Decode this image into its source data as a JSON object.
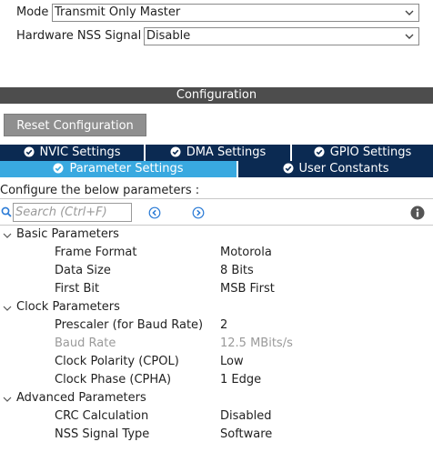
{
  "mode": {
    "label": "Mode",
    "value": "Transmit Only Master"
  },
  "nss": {
    "label": "Hardware NSS Signal",
    "value": "Disable"
  },
  "configuration": {
    "title": "Configuration",
    "reset_label": "Reset Configuration",
    "tabs_row1": [
      {
        "label": "NVIC Settings",
        "icon": "check-circle-icon"
      },
      {
        "label": "DMA Settings",
        "icon": "check-circle-icon"
      },
      {
        "label": "GPIO Settings",
        "icon": "check-circle-icon"
      }
    ],
    "tabs_row2": [
      {
        "label": "Parameter Settings",
        "icon": "check-circle-icon",
        "active": true
      },
      {
        "label": "User Constants",
        "icon": "check-circle-icon",
        "active": false
      }
    ],
    "note": "Configure the below parameters :",
    "search_placeholder": "Search (Ctrl+F)",
    "groups": [
      {
        "name": "Basic Parameters",
        "params": [
          {
            "name": "Frame Format",
            "value": "Motorola"
          },
          {
            "name": "Data Size",
            "value": "8 Bits"
          },
          {
            "name": "First Bit",
            "value": "MSB First"
          }
        ]
      },
      {
        "name": "Clock Parameters",
        "params": [
          {
            "name": "Prescaler (for Baud Rate)",
            "value": "2"
          },
          {
            "name": "Baud Rate",
            "value": "12.5 MBits/s",
            "disabled": true
          },
          {
            "name": "Clock Polarity (CPOL)",
            "value": "Low"
          },
          {
            "name": "Clock Phase (CPHA)",
            "value": "1 Edge"
          }
        ]
      },
      {
        "name": "Advanced Parameters",
        "params": [
          {
            "name": "CRC Calculation",
            "value": "Disabled"
          },
          {
            "name": "NSS Signal Type",
            "value": "Software"
          }
        ]
      }
    ]
  },
  "colors": {
    "tab_dark": "#0b2a52",
    "tab_active": "#39a9e0",
    "config_bar": "#4d4d4d",
    "reset_button": "#8f8f8f",
    "accent_blue": "#2b7bd6"
  }
}
